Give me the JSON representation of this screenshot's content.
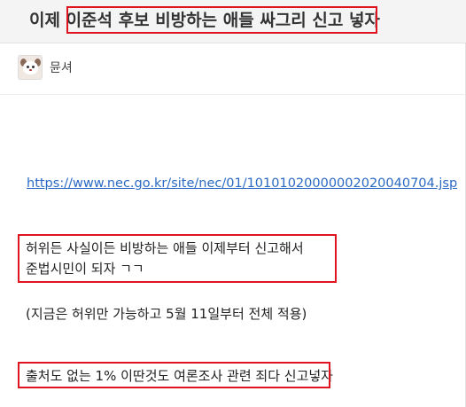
{
  "post": {
    "title": "이제 이준석 후보 비방하는 애들 싸그리 신고 넣자",
    "author": "뮨셔"
  },
  "content": {
    "link": "https://www.nec.go.kr/site/nec/01/10101020000002020040704.jsp",
    "line1": "허위든 사실이든 비방하는 애들 이제부터 신고해서",
    "line2": "준법시민이 되자 ㄱㄱ",
    "line3": "(지금은 허위만 가능하고 5월 11일부터 전체 적용)",
    "line4": "출처도 없는 1% 이딴것도 여론조사 관련 죄다 신고넣자"
  },
  "colors": {
    "highlight": "#e0141e",
    "link": "#2a6ac4"
  }
}
